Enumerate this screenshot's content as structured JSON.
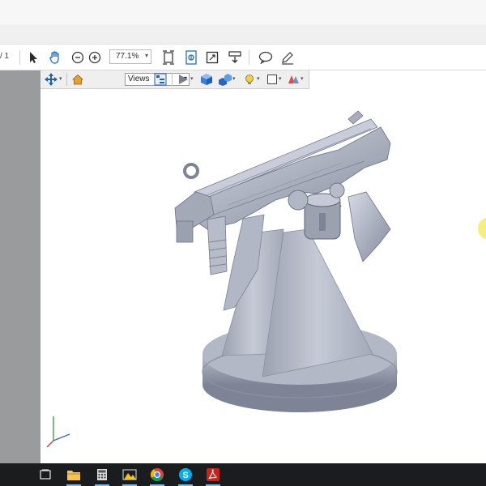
{
  "toolbar": {
    "page_fragment": "/ 1",
    "zoom_value": "77.1%"
  },
  "toolbar_3d": {
    "views_label": "Views"
  },
  "colors": {
    "model": "#a9aebd",
    "model_dark": "#7e8496",
    "model_light": "#d4d8e4",
    "sidebar_gray": "#9a9b9c",
    "taskbar": "#1b1c1e",
    "cursor_highlight": "#f6ee7e"
  },
  "taskbar": {
    "icons": [
      "task-view-icon",
      "file-explorer-icon",
      "calculator-icon",
      "photos-icon",
      "chrome-icon",
      "skype-icon",
      "acrobat-icon"
    ]
  }
}
